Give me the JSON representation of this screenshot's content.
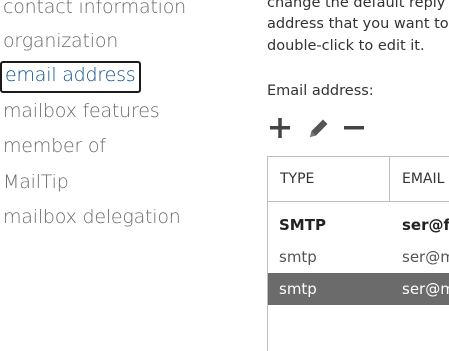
{
  "nav": {
    "items": [
      {
        "label": "contact information",
        "selected": false
      },
      {
        "label": "organization",
        "selected": false
      },
      {
        "label": "email address",
        "selected": true
      },
      {
        "label": "mailbox features",
        "selected": false
      },
      {
        "label": "member of",
        "selected": false
      },
      {
        "label": "MailTip",
        "selected": false
      },
      {
        "label": "mailbox delegation",
        "selected": false
      }
    ]
  },
  "content": {
    "description_lines": [
      "change the default reply",
      "address that you want to",
      "double-click to edit it."
    ],
    "email_label": "Email address:",
    "toolbar": {
      "add_icon": "plus-icon",
      "edit_icon": "pencil-icon",
      "remove_icon": "minus-icon"
    },
    "grid": {
      "columns": [
        "TYPE",
        "EMAIL"
      ],
      "rows": [
        {
          "type": "SMTP",
          "email": "ser@fo",
          "style": "bold"
        },
        {
          "type": "smtp",
          "email": "ser@m",
          "style": "normal"
        },
        {
          "type": "smtp",
          "email": "ser@m",
          "style": "selected"
        }
      ]
    }
  },
  "colors": {
    "selected_nav_text": "#0c4f8c",
    "selected_row_bg": "#6b6b6b"
  }
}
